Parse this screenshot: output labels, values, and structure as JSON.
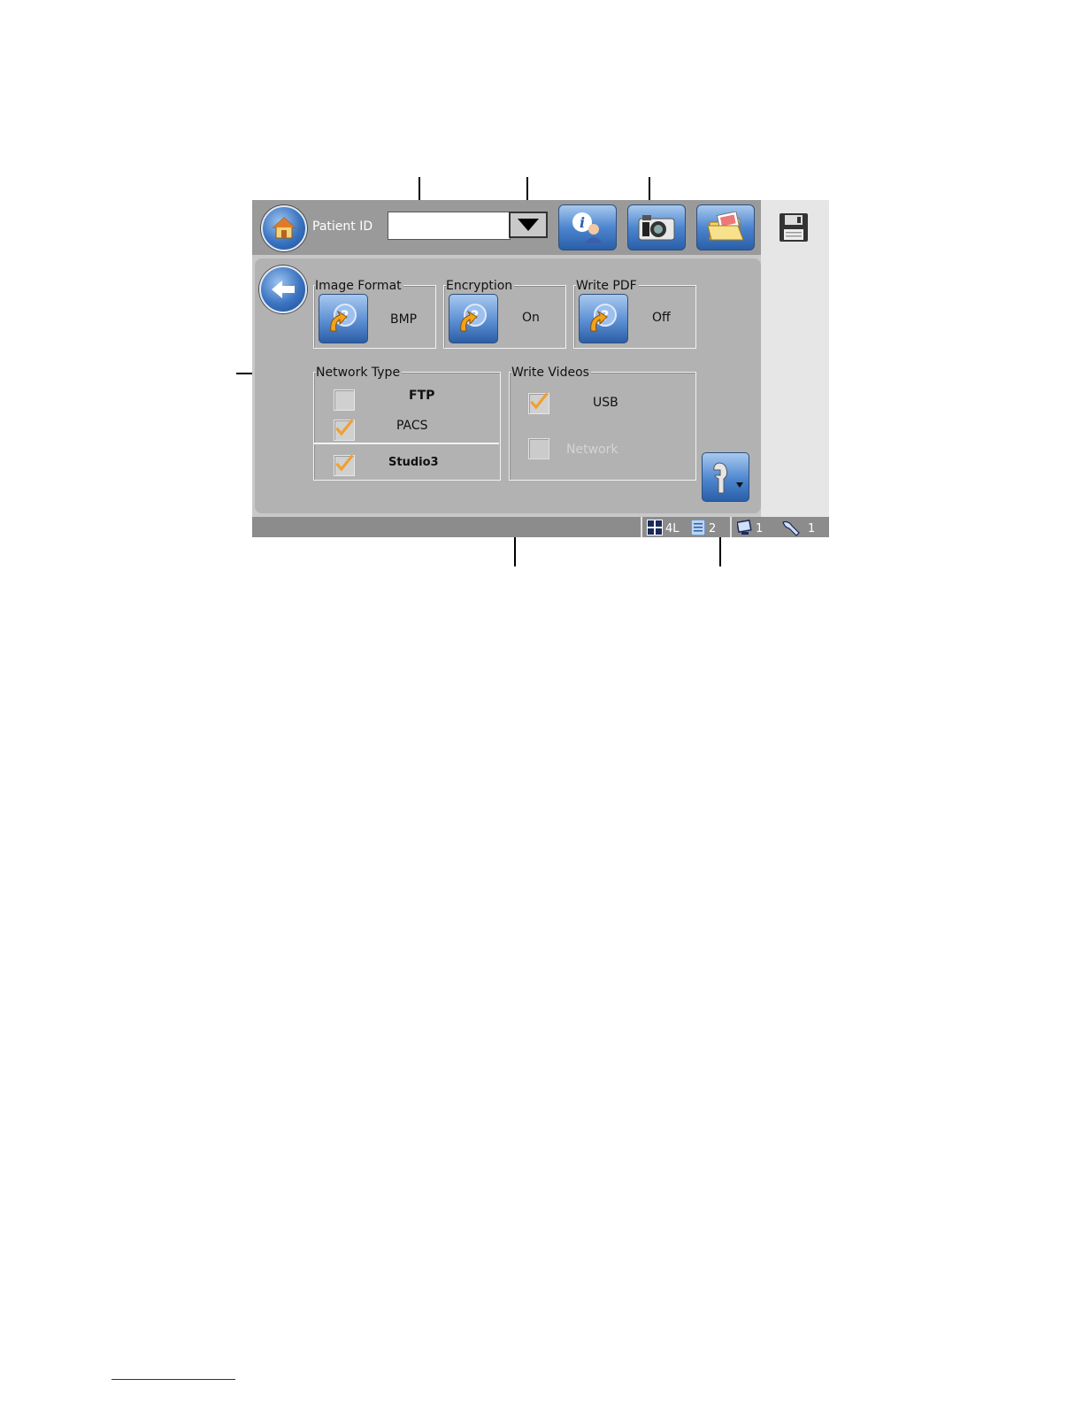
{
  "toolbar": {
    "patient_id_label": "Patient ID",
    "patient_id_value": "",
    "home_icon": "home-icon",
    "info_icon": "patient-info-icon",
    "camera_icon": "camera-icon",
    "folder_icon": "image-folder-icon",
    "save_icon": "floppy-disk-icon"
  },
  "settings": {
    "image_format": {
      "label": "Image Format",
      "value": "BMP"
    },
    "encryption": {
      "label": "Encryption",
      "value": "On"
    },
    "write_pdf": {
      "label": "Write PDF",
      "value": "Off"
    },
    "network_type": {
      "label": "Network Type",
      "options": [
        {
          "label": "FTP",
          "checked": false
        },
        {
          "label": "PACS",
          "checked": true
        },
        {
          "label": "Studio3",
          "checked": true
        }
      ]
    },
    "write_videos": {
      "label": "Write Videos",
      "options": [
        {
          "label": "USB",
          "checked": true,
          "enabled": true
        },
        {
          "label": "Network",
          "checked": false,
          "enabled": false
        }
      ]
    }
  },
  "statusbar": {
    "layout": "4L",
    "pages": "2",
    "monitors": "1",
    "probes": "1"
  },
  "colors": {
    "check": "#f0a030",
    "button_blue": "#3a73c0"
  }
}
